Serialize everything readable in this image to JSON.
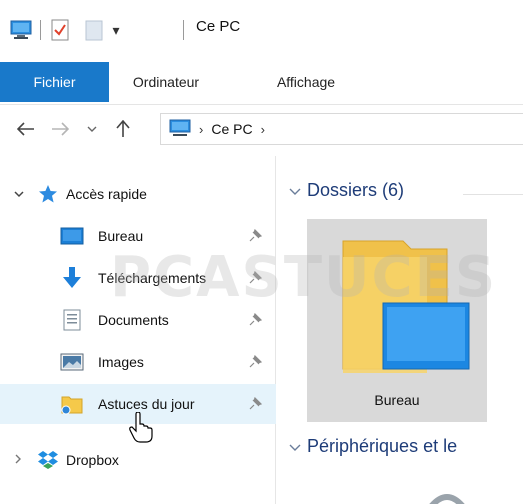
{
  "window": {
    "title": "Ce PC"
  },
  "quick_access_toolbar": {
    "icons": [
      "computer-icon",
      "properties-icon",
      "new-folder-icon",
      "customize-dropdown-icon"
    ]
  },
  "ribbon": {
    "tabs": [
      {
        "label": "Fichier",
        "active": true
      },
      {
        "label": "Ordinateur"
      },
      {
        "label": "Affichage"
      }
    ]
  },
  "address_bar": {
    "segments": [
      "Ce PC"
    ],
    "trailing_chevron": "›"
  },
  "navigation_pane": {
    "quick_access": {
      "label": "Accès rapide",
      "expanded": true,
      "items": [
        {
          "label": "Bureau",
          "icon": "desktop-icon",
          "pinned": true
        },
        {
          "label": "Téléchargements",
          "icon": "download-icon",
          "pinned": true
        },
        {
          "label": "Documents",
          "icon": "documents-icon",
          "pinned": true
        },
        {
          "label": "Images",
          "icon": "images-icon",
          "pinned": true
        },
        {
          "label": "Astuces du jour",
          "icon": "folder-icon",
          "pinned": true,
          "hovered": true
        }
      ]
    },
    "dropbox": {
      "label": "Dropbox",
      "expanded": false
    }
  },
  "content": {
    "groups": [
      {
        "label": "Dossiers (6)",
        "expanded": true
      },
      {
        "label": "Périphériques et le",
        "expanded": true
      }
    ],
    "folders": [
      {
        "label": "Bureau",
        "selected": true
      }
    ]
  },
  "watermark": "PCASTUCES",
  "colors": {
    "accent": "#1979ca",
    "hover": "#e5f3fb",
    "group_header": "#1e3c78",
    "selected_tile": "#d9d9d9"
  }
}
